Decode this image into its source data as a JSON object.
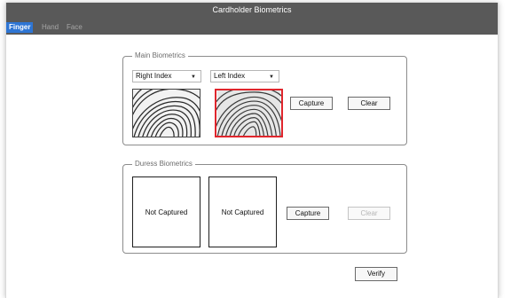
{
  "window": {
    "title": "Cardholder Biometrics"
  },
  "tabs": [
    {
      "label": "Finger",
      "active": true
    },
    {
      "label": "Hand",
      "active": false
    },
    {
      "label": "Face",
      "active": false
    }
  ],
  "main_biometrics": {
    "label": "Main Biometrics",
    "left_finger_select": {
      "value": "Right Index"
    },
    "right_finger_select": {
      "value": "Left Index"
    },
    "capture_label": "Capture",
    "clear_label": "Clear"
  },
  "duress_biometrics": {
    "label": "Duress Biometrics",
    "slot1_text": "Not Captured",
    "slot2_text": "Not Captured",
    "capture_label": "Capture",
    "clear_label": "Clear",
    "clear_enabled": false
  },
  "verify_label": "Verify",
  "colors": {
    "titlebar": "#595959",
    "active_tab": "#2e75d4",
    "selected_print_border": "#e0262d"
  }
}
